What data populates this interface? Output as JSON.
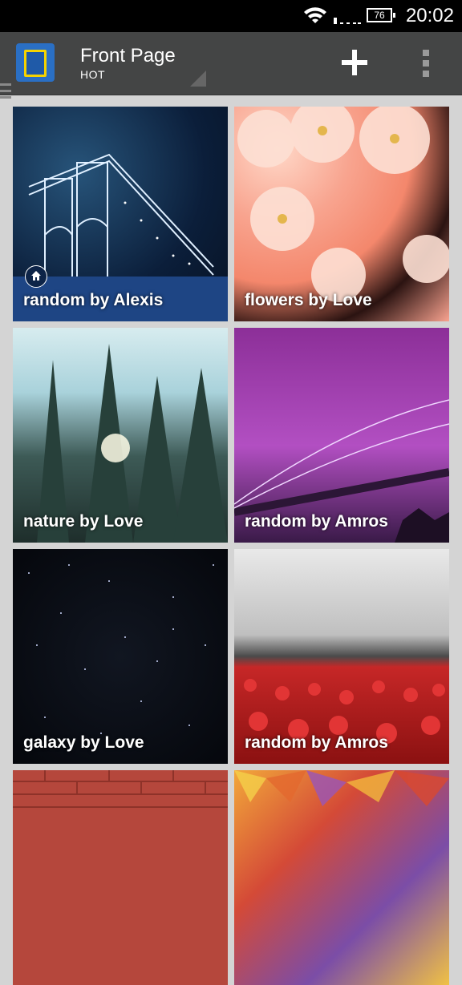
{
  "status_bar": {
    "time": "20:02",
    "battery": "76"
  },
  "action_bar": {
    "title": "Front Page",
    "subtitle": "HOT"
  },
  "tiles": [
    {
      "label": "random by Alexis"
    },
    {
      "label": "flowers by Love"
    },
    {
      "label": "nature by Love"
    },
    {
      "label": "random by Amros"
    },
    {
      "label": "galaxy by Love"
    },
    {
      "label": "random by Amros"
    },
    {
      "label": ""
    },
    {
      "label": ""
    }
  ],
  "icons": [
    "wifi-icon",
    "signal-icon",
    "battery-icon",
    "drawer-icon",
    "app-icon",
    "add-icon",
    "overflow-icon",
    "home-icon"
  ]
}
